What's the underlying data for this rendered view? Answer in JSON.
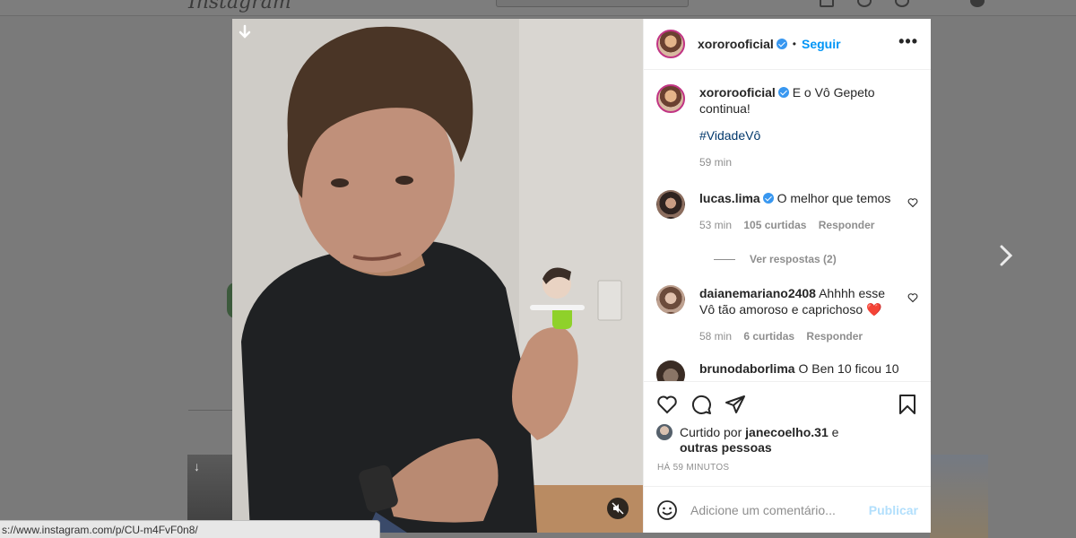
{
  "background": {
    "logo_text": "Instagram"
  },
  "post": {
    "username": "xororooficial",
    "follow_label": "Seguir",
    "more_label": "•••",
    "caption": "E o Vô Gepeto continua!",
    "hashtag": "#VidadeVô",
    "caption_time": "59 min"
  },
  "comments": [
    {
      "username": "lucas.lima",
      "verified": true,
      "text": "O melhor que temos",
      "time": "53 min",
      "likes": "105 curtidas",
      "reply_label": "Responder",
      "view_replies": "Ver respostas (2)"
    },
    {
      "username": "daianemariano2408",
      "verified": false,
      "text": "Ahhhh esse Vô tão amoroso e caprichoso ❤️",
      "time": "58 min",
      "likes": "6 curtidas",
      "reply_label": "Responder"
    },
    {
      "username": "brunodaborlima",
      "text": "O Ben 10 ficou 10"
    }
  ],
  "likes_info": {
    "prefix": "Curtido por",
    "user": "janecoelho.31",
    "suffix": "e",
    "others": "outras pessoas"
  },
  "posted_ago": "HÁ 59 MINUTOS",
  "add_comment": {
    "placeholder": "Adicione um comentário...",
    "publish_label": "Publicar"
  },
  "status_url": "s://www.instagram.com/p/CU-m4FvF0n8/",
  "colors": {
    "link_blue": "#0095f6",
    "verified_blue": "#3897f0",
    "publish_disabled": "#b2dffc",
    "overlay": "#7a7a7a"
  },
  "icons": [
    "download-arrow-icon",
    "mute-icon",
    "next-chevron-icon",
    "heart-icon",
    "comment-icon",
    "share-icon",
    "bookmark-icon",
    "emoji-icon",
    "verified-icon"
  ]
}
